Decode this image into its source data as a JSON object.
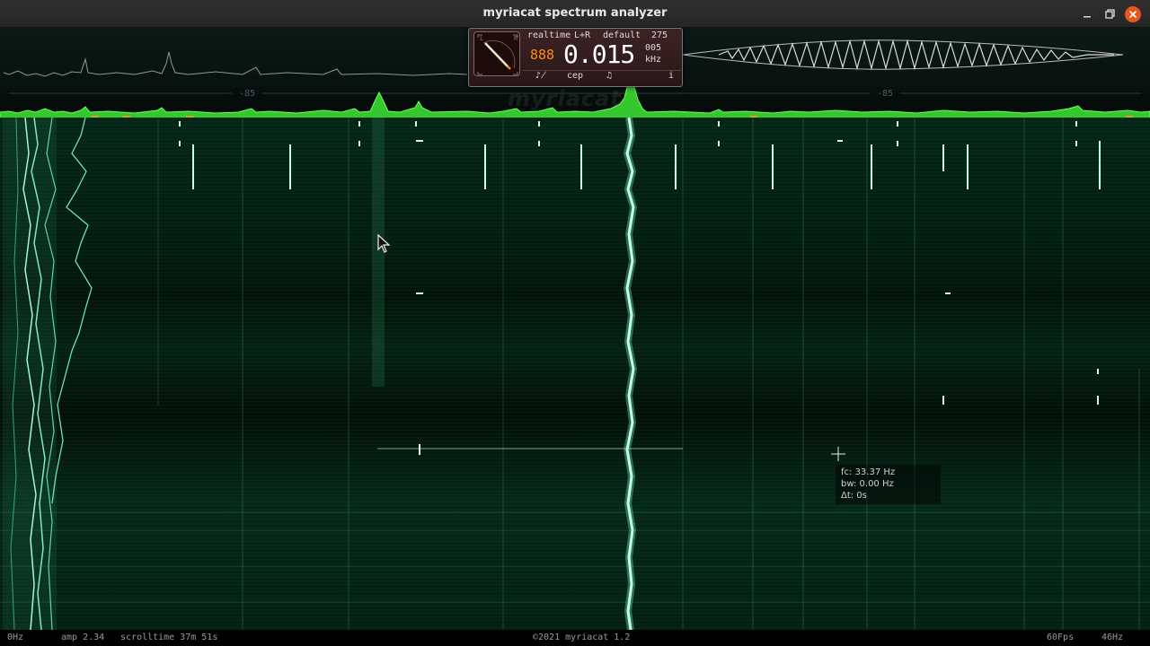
{
  "window": {
    "title": "myriacat spectrum analyzer"
  },
  "spectrum": {
    "db_left": "-85",
    "db_right": "-85",
    "watermark": "myriacat"
  },
  "panel": {
    "mode": "realtime",
    "channel": "L+R",
    "preset": "default",
    "count": "275",
    "small_digit": "888",
    "freq_display": "0.015",
    "freq_sub": "005",
    "freq_unit": "kHz",
    "btn_tuning": "♪̸",
    "btn_cep": "cep",
    "btn_note": "♫",
    "btn_info": "i"
  },
  "readout": {
    "fc": "fc: 33.37 Hz",
    "bw": "bw: 0.00 Hz",
    "dt": "Δt: 0s"
  },
  "status": {
    "left_freq": "0Hz",
    "amp": "amp 2.34",
    "scrolltime": "scrolltime 37m 51s",
    "copyright": "©2021 myriacat 1.2",
    "fps": "60Fps",
    "right_freq": "46Hz"
  },
  "colors": {
    "spectrum_green": "#3fd23a",
    "waterfall_bg": "#042013",
    "accent_orange": "#ff8c1a",
    "panel_bg": "#3c2426",
    "marker": "#d8a020"
  }
}
